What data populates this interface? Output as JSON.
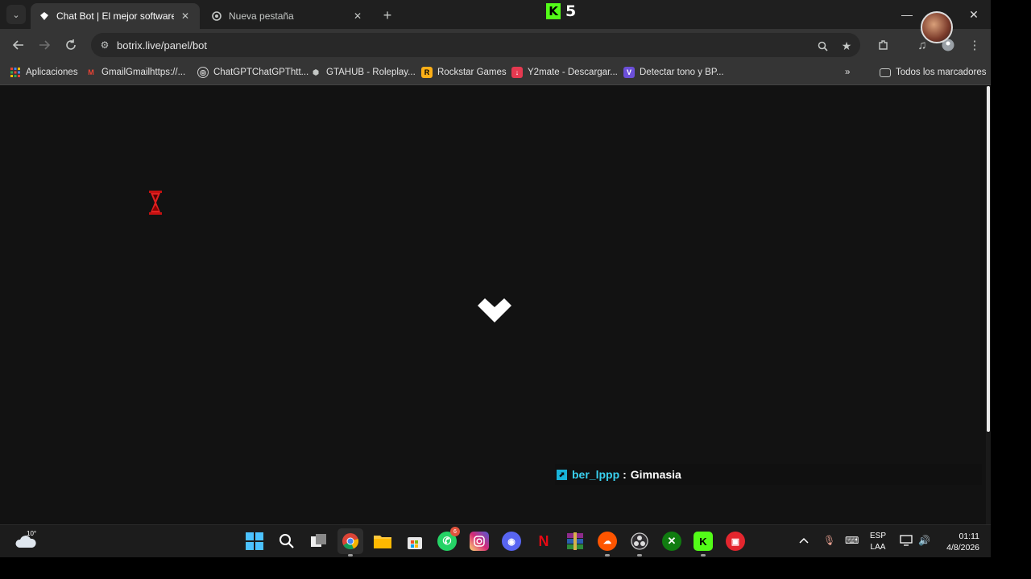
{
  "browser": {
    "tabs": [
      {
        "title": "Chat Bot | El mejor software pa",
        "active": true
      },
      {
        "title": "Nueva pestaña",
        "active": false
      }
    ],
    "url": "botrix.live/panel/bot",
    "bookmarks": [
      {
        "label": "Aplicaciones",
        "icon": "apps-grid-icon",
        "color": "#4285f4"
      },
      {
        "label": "GmailGmailhttps://...",
        "icon": "gmail-icon",
        "color": "#ea4335"
      },
      {
        "label": "ChatGPTChatGPThtt...",
        "icon": "chatgpt-icon",
        "color": "#e3e3e3"
      },
      {
        "label": "GTAHUB - Roleplay...",
        "icon": "gtahub-icon",
        "color": "#c4c7c5"
      },
      {
        "label": "Rockstar Games",
        "icon": "rockstar-icon",
        "color": "#fcaf17"
      },
      {
        "label": "Y2mate - Descargar...",
        "icon": "y2mate-icon",
        "color": "#e53950"
      },
      {
        "label": "Detectar tono y BP...",
        "icon": "v-icon",
        "color": "#6b4fd8"
      }
    ],
    "all_bookmarks_label": "Todos los marcadores"
  },
  "stream_overlay": {
    "kick_viewer_count": "5",
    "kick_color": "#53fc18"
  },
  "page": {
    "chat": {
      "username": "ber_lppp",
      "separator": ":",
      "message": "Gimnasia",
      "username_color": "#3ad1f0"
    }
  },
  "taskbar": {
    "weather_temp": "10°",
    "badge_count": "6",
    "language": "ESP",
    "keyboard_layout": "LAA",
    "time": "01:11",
    "date": "4/8/2026"
  }
}
